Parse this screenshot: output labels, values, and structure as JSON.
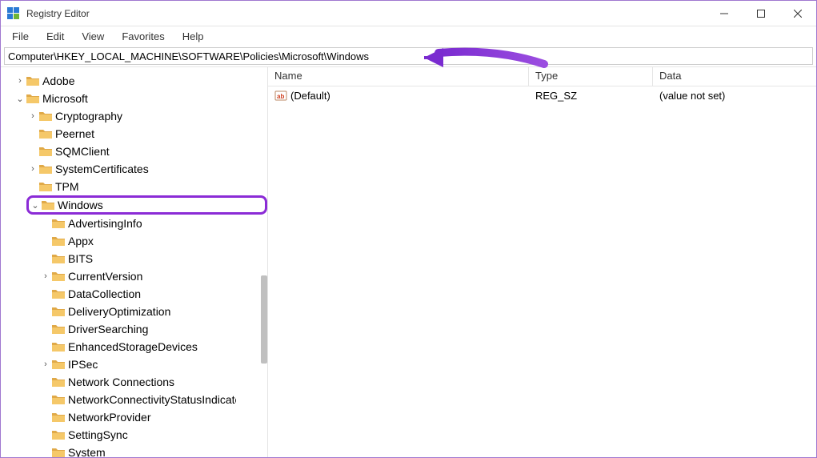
{
  "window": {
    "title": "Registry Editor"
  },
  "menu": {
    "file": "File",
    "edit": "Edit",
    "view": "View",
    "favorites": "Favorites",
    "help": "Help"
  },
  "address": "Computer\\HKEY_LOCAL_MACHINE\\SOFTWARE\\Policies\\Microsoft\\Windows",
  "tree": {
    "n0": "Adobe",
    "n1": "Microsoft",
    "n2": "Cryptography",
    "n3": "Peernet",
    "n4": "SQMClient",
    "n5": "SystemCertificates",
    "n6": "TPM",
    "n7": "Windows",
    "n8": "AdvertisingInfo",
    "n9": "Appx",
    "n10": "BITS",
    "n11": "CurrentVersion",
    "n12": "DataCollection",
    "n13": "DeliveryOptimization",
    "n14": "DriverSearching",
    "n15": "EnhancedStorageDevices",
    "n16": "IPSec",
    "n17": "Network Connections",
    "n18": "NetworkConnectivityStatusIndicator",
    "n19": "NetworkProvider",
    "n20": "SettingSync",
    "n21": "System"
  },
  "list": {
    "headers": {
      "name": "Name",
      "type": "Type",
      "data": "Data"
    },
    "row0": {
      "name": "(Default)",
      "type": "REG_SZ",
      "data": "(value not set)"
    }
  }
}
